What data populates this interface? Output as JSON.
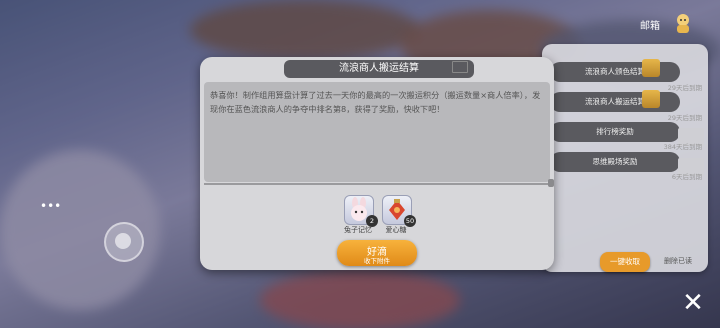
{
  "mailbox": {
    "title": "邮箱"
  },
  "mail_list": [
    {
      "title": "流浪商人颁色结算",
      "time": "29天后到期",
      "has_gift": true
    },
    {
      "title": "流浪商人搬运结算",
      "time": "29天后到期",
      "has_gift": true
    },
    {
      "title": "排行榜奖励",
      "time": "384天后到期",
      "has_gift": false
    },
    {
      "title": "思维殿场奖励",
      "time": "6天后到期",
      "has_gift": false
    }
  ],
  "mail_actions": {
    "collect_all": "一键收取",
    "delete_read": "删除已读"
  },
  "dialog": {
    "title": "流浪商人搬运结算",
    "message": "恭喜你！制作组用算盘计算了过去一天你的最高的一次搬运积分（搬运数量×商人倍率），发现你在蓝色流浪商人的争夺中排名第8，获得了奖励，快收下吧！",
    "rewards": [
      {
        "label": "兔子记忆",
        "count": "2",
        "icon": "bunny-icon"
      },
      {
        "label": "爱心糖",
        "count": "50",
        "icon": "candy-icon"
      }
    ],
    "confirm": {
      "label": "好滴",
      "sub": "收下附件"
    }
  },
  "colors": {
    "accent": "#e08a18",
    "panel": "#d7d7da",
    "header": "#5a5a5f"
  }
}
